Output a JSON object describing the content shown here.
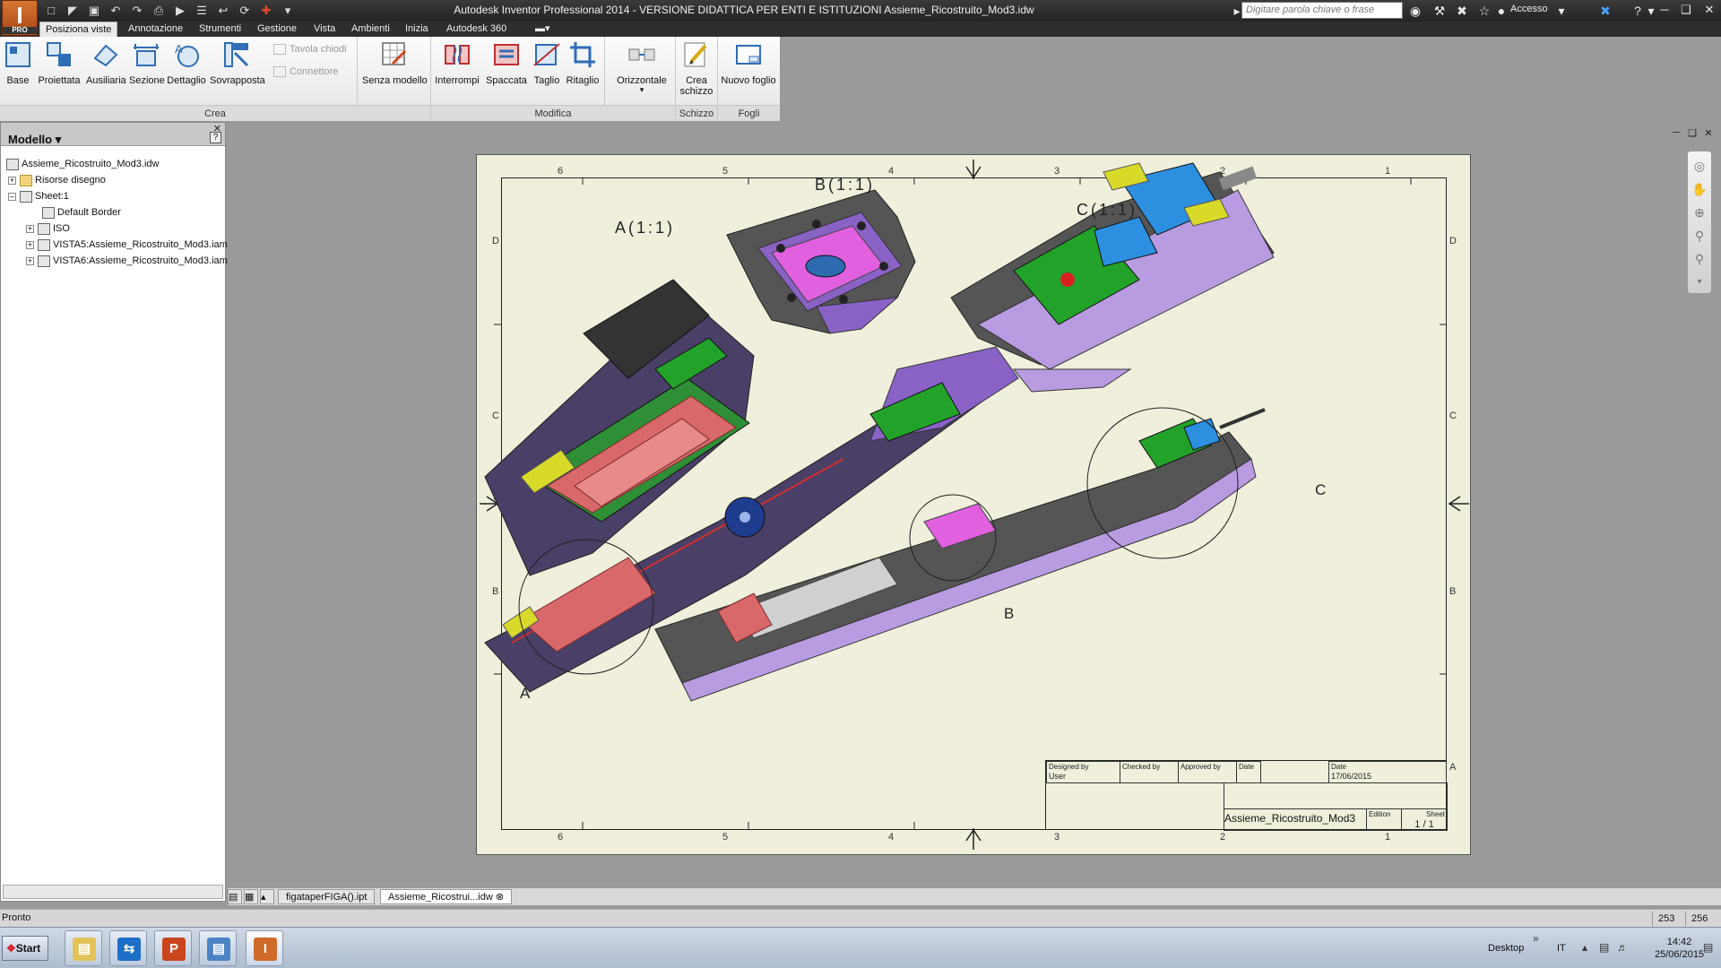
{
  "app": {
    "logo_letter": "I",
    "logo_badge": "PRO",
    "title": "Autodesk Inventor Professional 2014 - VERSIONE DIDATTICA PER ENTI E ISTITUZIONI    Assieme_Ricostruito_Mod3.idw",
    "search_placeholder": "Digitare parola chiave o frase",
    "login_label": "Accesso"
  },
  "ribbon": {
    "tabs": [
      "Posiziona viste",
      "Annotazione",
      "Strumenti",
      "Gestione",
      "Vista",
      "Ambienti",
      "Inizia",
      "Autodesk 360"
    ],
    "active_tab": "Posiziona viste",
    "crea": {
      "label": "Crea",
      "buttons": [
        "Base",
        "Proiettata",
        "Ausiliaria",
        "Sezione",
        "Dettaglio",
        "Sovrapposta"
      ],
      "small": [
        "Tavola chiodi",
        "Connettore"
      ],
      "senza_modello": "Senza modello"
    },
    "modifica": {
      "label": "Modifica",
      "buttons": [
        "Interrompi",
        "Spaccata",
        "Taglio",
        "Ritaglio"
      ],
      "orizzontale": "Orizzontale"
    },
    "schizzo": {
      "label": "Schizzo",
      "button_line1": "Crea",
      "button_line2": "schizzo"
    },
    "fogli": {
      "label": "Fogli",
      "button": "Nuovo foglio"
    }
  },
  "browser": {
    "title": "Modello",
    "tree": [
      {
        "label": "Assieme_Ricostruito_Mod3.idw",
        "level": 0,
        "expander": "",
        "icon": "drawing-icon"
      },
      {
        "label": "Risorse disegno",
        "level": 1,
        "expander": "+",
        "icon": "folder-icon"
      },
      {
        "label": "Sheet:1",
        "level": 1,
        "expander": "-",
        "icon": "sheet-icon"
      },
      {
        "label": "Default Border",
        "level": 2,
        "expander": "",
        "icon": "border-icon"
      },
      {
        "label": "ISO",
        "level": 2,
        "expander": "+",
        "icon": "titleblock-icon"
      },
      {
        "label": "VISTA5:Assieme_Ricostruito_Mod3.iam",
        "level": 2,
        "expander": "+",
        "icon": "view-icon"
      },
      {
        "label": "VISTA6:Assieme_Ricostruito_Mod3.iam",
        "level": 2,
        "expander": "+",
        "icon": "view-icon"
      }
    ]
  },
  "drawing": {
    "zones_top": [
      "6",
      "5",
      "4",
      "3",
      "2",
      "1"
    ],
    "zones_side": [
      "D",
      "C",
      "B",
      "A"
    ],
    "views": {
      "a_label": "A(1:1)",
      "b_label": "B(1:1)",
      "c_label": "C(1:1)",
      "detail_a": "A",
      "detail_b": "B",
      "detail_c": "C"
    },
    "title_block": {
      "designed_by_label": "Designed by",
      "designed_by": "User",
      "checked_by_label": "Checked by",
      "approved_by_label": "Approved by",
      "date_label": "Date",
      "date2_label": "Date",
      "date": "17/06/2015",
      "name": "Assieme_Ricostruito_Mod3",
      "edition_label": "Edition",
      "sheet_label": "Sheet",
      "sheet": "1 / 1"
    }
  },
  "doc_tabs": [
    "figataperFIGA().ipt",
    "Assieme_Ricostrui...idw"
  ],
  "status": {
    "text": "Pronto",
    "n1": "253",
    "n2": "256"
  },
  "taskbar": {
    "start": "Start",
    "desktop": "Desktop",
    "lang": "IT",
    "time": "14:42",
    "date": "25/06/2015"
  },
  "colors": {
    "purple": "#8a62c6",
    "dark_purple": "#4a3a6a",
    "green": "#23a22a",
    "pink": "#e060e0",
    "red": "#d8686a",
    "blue": "#2d8fe0",
    "yellow": "#d9d92a"
  }
}
